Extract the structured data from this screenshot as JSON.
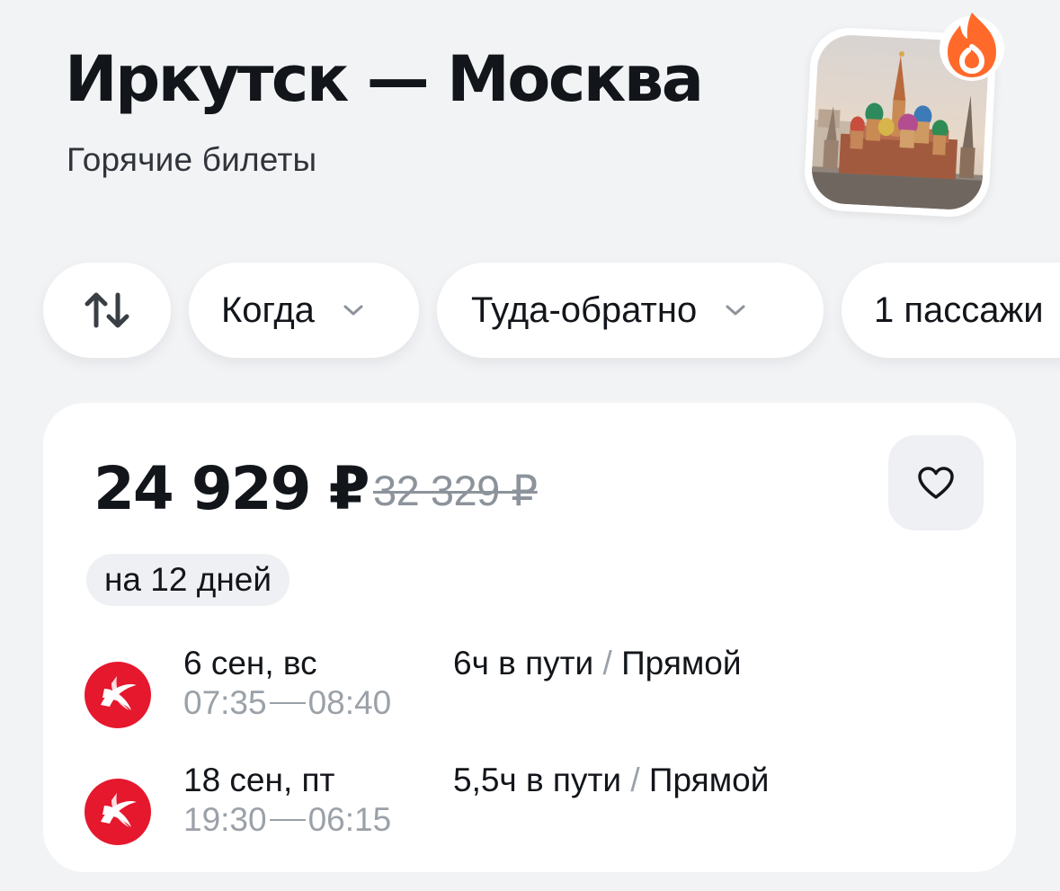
{
  "header": {
    "title": "Иркутск — Москва",
    "subtitle": "Горячие билеты"
  },
  "cover": {
    "image": "saint-basils-cathedral",
    "badge_icon": "fire-icon",
    "badge_color": "#ff6a2b"
  },
  "filters": {
    "swap_icon": "swap-arrows-icon",
    "when_label": "Когда",
    "trip_type_label": "Туда-обратно",
    "passengers_label": "1 пассажи"
  },
  "ticket": {
    "price": "24 929 ₽",
    "old_price": "32 329 ₽",
    "duration_tag": "на 12 дней",
    "favorite_icon": "heart-icon",
    "segments": [
      {
        "date": "6 сен, вс",
        "depart": "07:35",
        "arrive": "08:40",
        "duration": "6ч в пути",
        "separator": "/",
        "type": "Прямой",
        "airline_icon": "airline-logo-icon"
      },
      {
        "date": "18 сен, пт",
        "depart": "19:30",
        "arrive": "06:15",
        "duration": "5,5ч в пути",
        "separator": "/",
        "type": "Прямой",
        "airline_icon": "airline-logo-icon"
      }
    ]
  },
  "colors": {
    "background": "#f2f3f5",
    "card": "#ffffff",
    "accent_orange": "#ff6a2b",
    "airline_red": "#e5182d",
    "muted_text": "#9ba1a8"
  }
}
